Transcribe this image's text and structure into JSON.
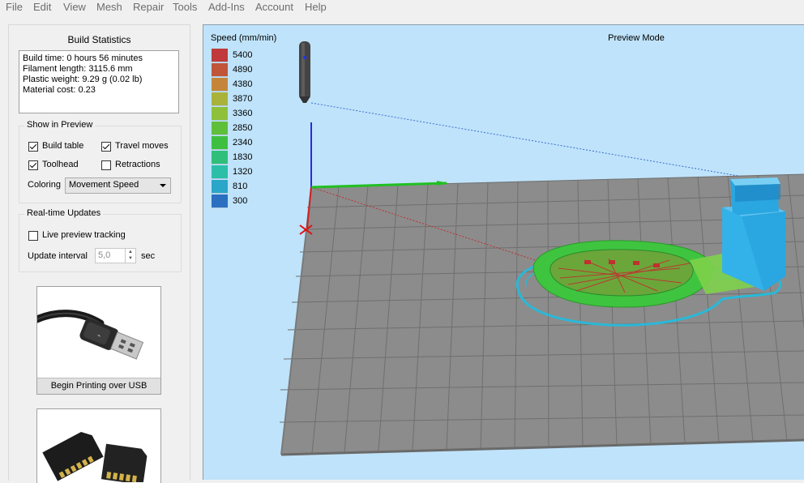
{
  "menu": [
    "File",
    "Edit",
    "View",
    "Mesh",
    "Repair",
    "Tools",
    "Add-Ins",
    "Account",
    "Help"
  ],
  "stats": {
    "title": "Build Statistics",
    "lines": [
      "Build time: 0 hours 56 minutes",
      "Filament length: 3115.6 mm",
      "Plastic weight: 9.29 g (0.02 lb)",
      "Material cost: 0.23"
    ]
  },
  "show": {
    "title": "Show in Preview",
    "build_table": "Build table",
    "travel_moves": "Travel moves",
    "toolhead": "Toolhead",
    "retractions": "Retractions",
    "coloring_label": "Coloring",
    "coloring_value": "Movement Speed"
  },
  "realtime": {
    "title": "Real-time Updates",
    "live_tracking": "Live preview tracking",
    "interval_label": "Update interval",
    "interval_value": "5,0",
    "interval_unit": "sec"
  },
  "cards": {
    "usb_label": "Begin Printing over USB"
  },
  "viewport": {
    "legend_title": "Speed (mm/min)",
    "mode": "Preview Mode",
    "legend": [
      {
        "value": "5400",
        "color": "#c0393b"
      },
      {
        "value": "4890",
        "color": "#c0553a"
      },
      {
        "value": "4380",
        "color": "#c4853a"
      },
      {
        "value": "3870",
        "color": "#a9b23a"
      },
      {
        "value": "3360",
        "color": "#8ec03a"
      },
      {
        "value": "2850",
        "color": "#5fbf3a"
      },
      {
        "value": "2340",
        "color": "#3fbf3f"
      },
      {
        "value": "1830",
        "color": "#2fbf7a"
      },
      {
        "value": "1320",
        "color": "#2bbfa8"
      },
      {
        "value": "810",
        "color": "#2aa6c8"
      },
      {
        "value": "300",
        "color": "#2a6fc0"
      }
    ]
  }
}
